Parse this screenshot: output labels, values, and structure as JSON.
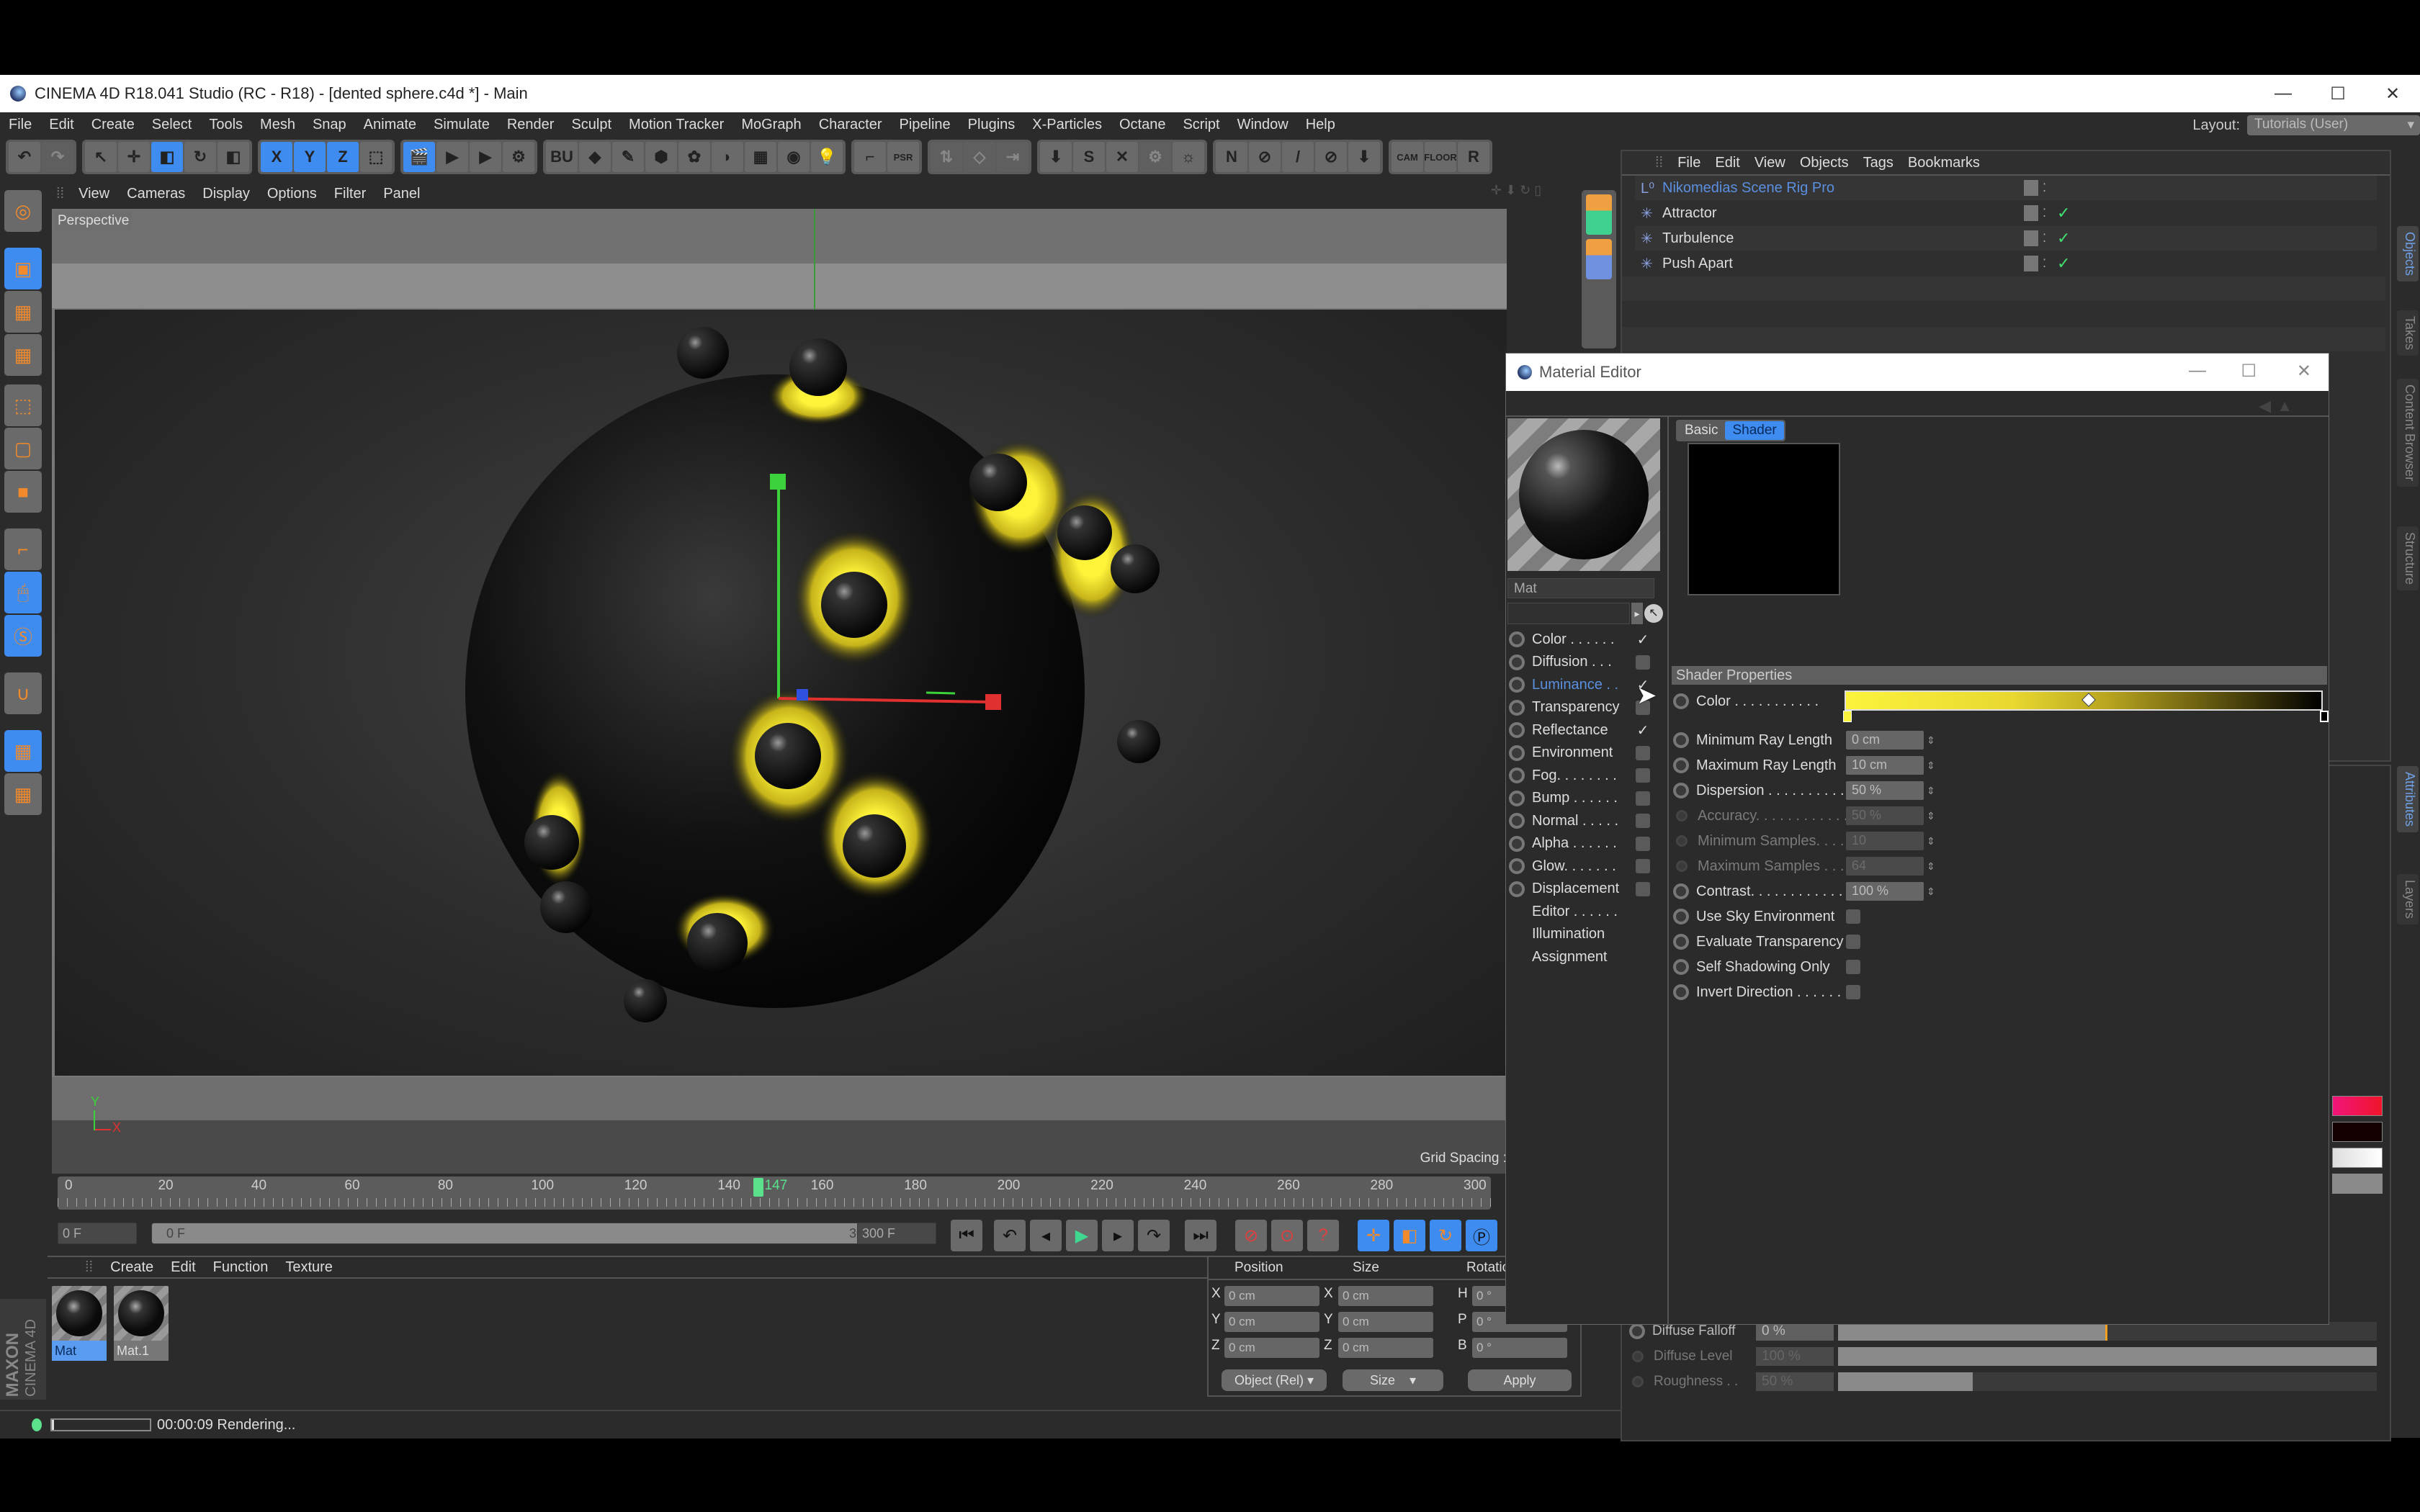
{
  "window": {
    "title": "CINEMA 4D R18.041 Studio (RC - R18) - [dented sphere.c4d *] - Main",
    "controls": {
      "minimize": "—",
      "maximize": "☐",
      "close": "✕"
    }
  },
  "menubar": {
    "items": [
      "File",
      "Edit",
      "Create",
      "Select",
      "Tools",
      "Mesh",
      "Snap",
      "Animate",
      "Simulate",
      "Render",
      "Sculpt",
      "Motion Tracker",
      "MoGraph",
      "Character",
      "Pipeline",
      "Plugins",
      "X-Particles",
      "Octane",
      "Script",
      "Window",
      "Help"
    ],
    "layout_label": "Layout:",
    "layout_value": "Tutorials (User)"
  },
  "toolbar": {
    "groups": [
      {
        "name": "history",
        "buttons": [
          {
            "icon": "undo-icon",
            "glyph": "↶",
            "active": false
          },
          {
            "icon": "redo-icon",
            "glyph": "↷",
            "active": false,
            "dim": true
          }
        ]
      },
      {
        "name": "tools",
        "buttons": [
          {
            "icon": "select-icon",
            "glyph": "↖",
            "active": false
          },
          {
            "icon": "move-icon",
            "glyph": "✛",
            "active": false
          },
          {
            "icon": "scale-icon",
            "glyph": "◧",
            "active": true
          },
          {
            "icon": "rotate-icon",
            "glyph": "↻",
            "active": false
          },
          {
            "icon": "recent-tool-icon",
            "glyph": "◧",
            "active": false
          }
        ]
      },
      {
        "name": "axes",
        "buttons": [
          {
            "icon": "x-axis-icon",
            "glyph": "X",
            "active": true
          },
          {
            "icon": "y-axis-icon",
            "glyph": "Y",
            "active": true
          },
          {
            "icon": "z-axis-icon",
            "glyph": "Z",
            "active": true
          },
          {
            "icon": "coordinate-system-icon",
            "glyph": "⬚",
            "active": false
          }
        ]
      },
      {
        "name": "render",
        "buttons": [
          {
            "icon": "render-region-icon",
            "glyph": "🎬",
            "active": true
          },
          {
            "icon": "render-view-icon",
            "glyph": "▶",
            "active": false
          },
          {
            "icon": "render-picture-viewer-icon",
            "glyph": "▶",
            "active": false
          },
          {
            "icon": "render-settings-icon",
            "glyph": "⚙",
            "active": false
          }
        ]
      },
      {
        "name": "objects",
        "buttons": [
          {
            "icon": "bu-icon",
            "glyph": "BU",
            "active": false
          },
          {
            "icon": "cube-icon",
            "glyph": "◆",
            "active": false
          },
          {
            "icon": "pen-icon",
            "glyph": "✎",
            "active": false
          },
          {
            "icon": "subdivision-icon",
            "glyph": "⬢",
            "active": false
          },
          {
            "icon": "cloner-icon",
            "glyph": "✿",
            "active": false
          },
          {
            "icon": "deformer-icon",
            "glyph": "◗",
            "active": false
          },
          {
            "icon": "floor-icon",
            "glyph": "▦",
            "active": false
          },
          {
            "icon": "camera-icon",
            "glyph": "◉",
            "active": false
          },
          {
            "icon": "light-icon",
            "glyph": "💡",
            "active": false
          }
        ]
      },
      {
        "name": "misc",
        "buttons": [
          {
            "icon": "xref-icon",
            "glyph": "⌐",
            "active": false
          },
          {
            "icon": "psr-icon",
            "glyph": "PSR",
            "active": false
          }
        ]
      },
      {
        "name": "disabled",
        "buttons": [
          {
            "icon": "align-icon",
            "glyph": "⇅",
            "active": false,
            "dim": true
          },
          {
            "icon": "cube-outline-icon",
            "glyph": "◇",
            "active": false,
            "dim": true
          },
          {
            "icon": "arrange-icon",
            "glyph": "⇥",
            "active": false,
            "dim": true
          }
        ]
      },
      {
        "name": "plugins",
        "buttons": [
          {
            "icon": "drop-to-floor-icon",
            "glyph": "⬇",
            "active": false
          },
          {
            "icon": "s-plugin-icon",
            "glyph": "S",
            "active": false
          },
          {
            "icon": "scatter-icon",
            "glyph": "✕",
            "active": false
          },
          {
            "icon": "gear-outline-icon",
            "glyph": "⚙",
            "active": false,
            "dim": true
          },
          {
            "icon": "sun-icon",
            "glyph": "☼",
            "active": false
          }
        ]
      },
      {
        "name": "plugins2",
        "buttons": [
          {
            "icon": "n-plugin-icon",
            "glyph": "N",
            "active": false
          },
          {
            "icon": "no-icon",
            "glyph": "⊘",
            "active": false
          },
          {
            "icon": "slash-icon",
            "glyph": "/",
            "active": false
          },
          {
            "icon": "no-slash-icon",
            "glyph": "⊘",
            "active": false
          },
          {
            "icon": "render-down-icon",
            "glyph": "⬇",
            "active": false
          }
        ]
      },
      {
        "name": "cam",
        "buttons": [
          {
            "icon": "cam-icon",
            "glyph": "CAM",
            "active": false
          },
          {
            "icon": "floor-plugin-icon",
            "glyph": "FLOOR",
            "active": false
          },
          {
            "icon": "r-plugin-icon",
            "glyph": "R",
            "active": false
          }
        ]
      }
    ]
  },
  "left_tools": [
    {
      "icon": "make-editable-icon",
      "active": false
    },
    {
      "icon": "model-mode-icon",
      "active": true
    },
    {
      "icon": "texture-mode-icon",
      "active": false
    },
    {
      "icon": "workplane-icon",
      "active": false
    },
    {
      "icon": "points-mode-icon",
      "active": false
    },
    {
      "icon": "edges-mode-icon",
      "active": false
    },
    {
      "icon": "polygons-mode-icon",
      "active": false
    },
    {
      "icon": "axis-mode-icon",
      "active": false
    },
    {
      "icon": "tweak-mode-icon",
      "active": true
    },
    {
      "icon": "solo-icon",
      "active": true
    },
    {
      "icon": "snap-magnet-icon",
      "active": false
    },
    {
      "icon": "locked-workplane-icon",
      "active": true
    },
    {
      "icon": "workplane-align-icon",
      "active": false
    }
  ],
  "viewport": {
    "menu": [
      "View",
      "Cameras",
      "Display",
      "Options",
      "Filter",
      "Panel"
    ],
    "label": "Perspective",
    "grid_spacing": "Grid Spacing :"
  },
  "timeline": {
    "ticks": [
      "0",
      "20",
      "40",
      "60",
      "80",
      "100",
      "120",
      "140",
      "160",
      "180",
      "200",
      "220",
      "240",
      "260",
      "280",
      "300"
    ],
    "current_frame": "147",
    "min_frame": 0,
    "max_frame": 300
  },
  "playback": {
    "current_field": "0 F",
    "range_start": "0 F",
    "range_end": "300 F",
    "end_field": "300 F"
  },
  "material_manager": {
    "menu": [
      "Create",
      "Edit",
      "Function",
      "Texture"
    ],
    "materials": [
      {
        "name": "Mat",
        "selected": true
      },
      {
        "name": "Mat.1",
        "selected": false
      }
    ],
    "brand_line1": "MAXON",
    "brand_line2": "CINEMA 4D"
  },
  "coordinates": {
    "headers": [
      "Position",
      "Size",
      "Rotation"
    ],
    "rows": [
      {
        "pos_axis": "X",
        "pos": "0 cm",
        "size_axis": "X",
        "size": "0 cm",
        "rot_axis": "H",
        "rot": "0 °"
      },
      {
        "pos_axis": "Y",
        "pos": "0 cm",
        "size_axis": "Y",
        "size": "0 cm",
        "rot_axis": "P",
        "rot": "0 °"
      },
      {
        "pos_axis": "Z",
        "pos": "0 cm",
        "size_axis": "Z",
        "size": "0 cm",
        "rot_axis": "B",
        "rot": "0 °"
      }
    ],
    "mode_dropdown": "Object (Rel)",
    "size_dropdown": "Size",
    "apply_label": "Apply"
  },
  "status": {
    "time": "00:00:09 Rendering...",
    "progress": 0.02
  },
  "object_manager": {
    "menu": [
      "File",
      "Edit",
      "View",
      "Objects",
      "Tags",
      "Bookmarks"
    ],
    "objects": [
      {
        "name": "Nikomedias Scene Rig Pro",
        "icon": "null-object-icon",
        "highlighted": true,
        "enabled": false
      },
      {
        "name": "Attractor",
        "icon": "attractor-icon",
        "highlighted": false,
        "enabled": true
      },
      {
        "name": "Turbulence",
        "icon": "turbulence-icon",
        "highlighted": false,
        "enabled": true
      },
      {
        "name": "Push Apart",
        "icon": "push-apart-icon",
        "highlighted": false,
        "enabled": true
      }
    ]
  },
  "right_tabs": {
    "top": [
      "Objects",
      "Takes",
      "Content Browser",
      "Structure"
    ],
    "bottom": [
      "Attributes",
      "Layers"
    ]
  },
  "attributes_partial": {
    "rows": [
      {
        "label": "Diffuse Falloff",
        "value": "0 %",
        "slider": 0.5,
        "dim": false
      },
      {
        "label": "Diffuse Level",
        "value": "100 %",
        "slider": 1.0,
        "dim": true
      },
      {
        "label": "Roughness . .",
        "value": "50 %",
        "slider": 0.25,
        "dim": true
      }
    ],
    "swatches": [
      "#f0157a",
      "#120000",
      "#ffffff",
      "#8a8a8a"
    ]
  },
  "material_editor": {
    "title": "Material Editor",
    "material_name": "Mat",
    "channels": [
      {
        "label": "Color . . . . . .",
        "checked": true,
        "has_radio": true
      },
      {
        "label": "Diffusion . . .",
        "checked": false,
        "has_radio": true
      },
      {
        "label": "Luminance . .",
        "checked": true,
        "has_radio": true,
        "active": true
      },
      {
        "label": "Transparency",
        "checked": false,
        "has_radio": true
      },
      {
        "label": "Reflectance",
        "checked": true,
        "has_radio": true
      },
      {
        "label": "Environment",
        "checked": false,
        "has_radio": true
      },
      {
        "label": "Fog. . . . . . . .",
        "checked": false,
        "has_radio": true
      },
      {
        "label": "Bump . . . . . .",
        "checked": false,
        "has_radio": true
      },
      {
        "label": "Normal . . . . .",
        "checked": false,
        "has_radio": true
      },
      {
        "label": "Alpha . . . . . .",
        "checked": false,
        "has_radio": true
      },
      {
        "label": "Glow. . . . . . .",
        "checked": false,
        "has_radio": true
      },
      {
        "label": "Displacement",
        "checked": false,
        "has_radio": true
      },
      {
        "label": "Editor . . . . . .",
        "checked": null,
        "has_radio": false
      },
      {
        "label": "Illumination",
        "checked": null,
        "has_radio": false
      },
      {
        "label": "Assignment",
        "checked": null,
        "has_radio": false
      }
    ],
    "tabs": [
      {
        "label": "Basic",
        "active": false
      },
      {
        "label": "Shader",
        "active": true
      }
    ],
    "section_title": "Shader Properties",
    "color_label": "Color . . . . . . . . . . .",
    "gradient": {
      "stops": [
        {
          "pos": 0,
          "color": "#fbf33c"
        },
        {
          "pos": 1,
          "color": "#000000"
        }
      ],
      "midpoint": 0.5
    },
    "properties": [
      {
        "label": "Minimum Ray Length",
        "value": "0 cm",
        "type": "number",
        "dim": false
      },
      {
        "label": "Maximum Ray Length",
        "value": "10 cm",
        "type": "number",
        "dim": false
      },
      {
        "label": "Dispersion . . . . . . . . . .",
        "value": "50 %",
        "type": "number",
        "dim": false
      },
      {
        "label": "Accuracy. . . . . . . . . . . .",
        "value": "50 %",
        "type": "number",
        "dim": true
      },
      {
        "label": "Minimum Samples. . . .",
        "value": "10",
        "type": "number",
        "dim": true
      },
      {
        "label": "Maximum Samples . . .",
        "value": "64",
        "type": "number",
        "dim": true
      },
      {
        "label": "Contrast. . . . . . . . . . . .",
        "value": "100 %",
        "type": "number",
        "dim": false
      },
      {
        "label": "Use Sky Environment",
        "value": false,
        "type": "checkbox",
        "dim": false
      },
      {
        "label": "Evaluate Transparency",
        "value": false,
        "type": "checkbox",
        "dim": false
      },
      {
        "label": "Self Shadowing Only",
        "value": false,
        "type": "checkbox",
        "dim": false
      },
      {
        "label": "Invert Direction . . . . . .",
        "value": false,
        "type": "checkbox",
        "dim": false
      }
    ]
  },
  "colors": {
    "accent": "#3f8cf0",
    "highlight_text": "#5b8fe0",
    "playhead": "#5be08c",
    "luminance_yellow": "#fbf33c"
  }
}
